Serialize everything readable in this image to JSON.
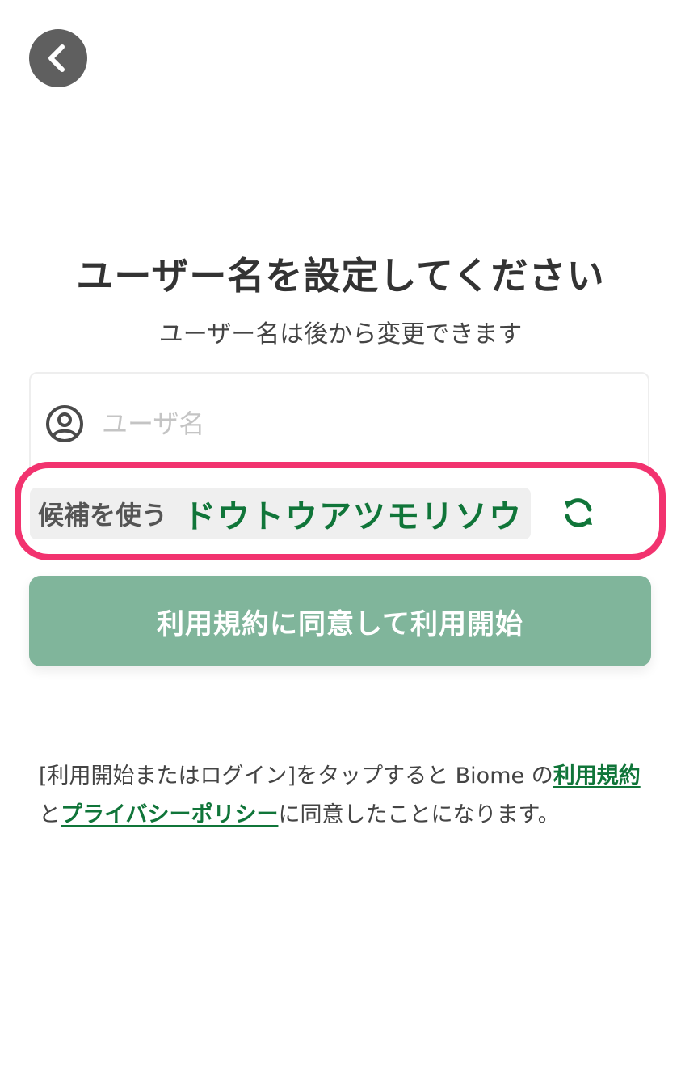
{
  "header": {
    "back_icon": "chevron-left-icon"
  },
  "main": {
    "title": "ユーザー名を設定してください",
    "subtitle": "ユーザー名は後から変更できます",
    "username_field": {
      "icon": "user-circle-icon",
      "placeholder": "ユーザ名",
      "value": ""
    },
    "suggestion": {
      "label": "候補を使う",
      "name": "ドウトウアツモリソウ",
      "refresh_icon": "refresh-icon"
    },
    "start_button_label": "利用規約に同意して利用開始"
  },
  "terms": {
    "text_before": "[利用開始またはログイン]をタップすると Biome の",
    "terms_link": "利用規約",
    "text_middle": "と",
    "privacy_link": "プライバシーポリシー",
    "text_after": "に同意したことになります。"
  },
  "colors": {
    "accent_green": "#107539",
    "button_green": "#80b59b",
    "highlight_pink": "#f2336f",
    "back_button_gray": "#5f5f5f"
  }
}
